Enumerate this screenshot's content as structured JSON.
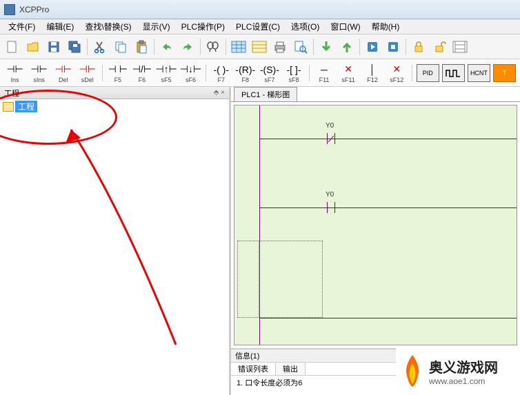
{
  "app": {
    "title": "XCPPro"
  },
  "menu": {
    "file": "文件(F)",
    "edit": "编辑(E)",
    "search": "查找\\替换(S)",
    "view": "显示(V)",
    "plcop": "PLC操作(P)",
    "plcset": "PLC设置(C)",
    "option": "选项(O)",
    "window": "窗口(W)",
    "help": "帮助(H)"
  },
  "ladder_toolbar": {
    "ins": "Ins",
    "sins": "sIns",
    "del": "Del",
    "sdel": "sDel",
    "f5": "F5",
    "f6": "F6",
    "sf5": "sF5",
    "sf6": "sF6",
    "f7": "F7",
    "f8": "F8",
    "sf7": "sF7",
    "sf8": "sF8",
    "f11": "F11",
    "sf11": "sF11",
    "f12": "F12",
    "sf12": "sF12",
    "pid": "PID",
    "hcnt": "HCNT",
    "t": "T"
  },
  "sidebar": {
    "header": "工程",
    "pin": "⬘ ×",
    "tree_root": "工程"
  },
  "editor": {
    "tab": "PLC1 - 梯形图",
    "rung1_label": "Y0",
    "rung2_label": "Y0"
  },
  "info": {
    "header": "信息(1)",
    "tab_err": "错误列表",
    "tab_out": "输出",
    "line1": "1. 口令长度必须为6"
  },
  "watermark": {
    "title": "奥义游戏网",
    "url": "www.aoe1.com"
  }
}
